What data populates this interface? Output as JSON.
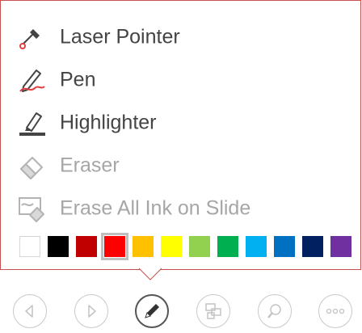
{
  "menu": {
    "items": [
      {
        "label": "Laser Pointer",
        "icon": "laser-pointer-icon",
        "enabled": true
      },
      {
        "label": "Pen",
        "icon": "pen-icon",
        "enabled": true
      },
      {
        "label": "Highlighter",
        "icon": "highlighter-icon",
        "enabled": true
      },
      {
        "label": "Eraser",
        "icon": "eraser-icon",
        "enabled": false
      },
      {
        "label": "Erase All Ink on Slide",
        "icon": "erase-all-ink-icon",
        "enabled": false
      }
    ],
    "colors": [
      "#ffffff",
      "#000000",
      "#c00000",
      "#ff0000",
      "#ffc000",
      "#ffff00",
      "#92d050",
      "#00b050",
      "#00b0f0",
      "#0070c0",
      "#002060",
      "#7030a0"
    ],
    "selected_color": "#ff0000",
    "border_color": "#c75050"
  },
  "toolbar": {
    "buttons": [
      "previous-slide",
      "next-slide",
      "pen-tools",
      "see-all-slides",
      "zoom",
      "more-options"
    ],
    "active": "pen-tools"
  }
}
